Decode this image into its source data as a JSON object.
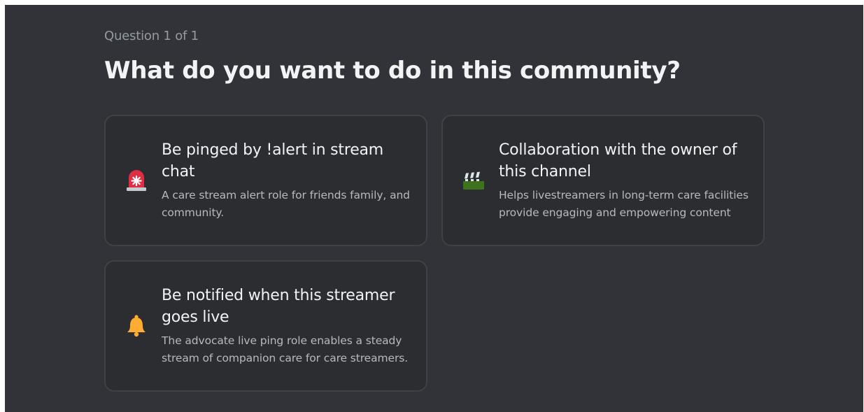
{
  "progress": "Question 1 of 1",
  "question": "What do you want to do in this community?",
  "options": [
    {
      "title": "Be pinged by !alert in stream chat",
      "description": "A care stream alert role for friends family, and community.",
      "icon": "rotating-light-icon"
    },
    {
      "title": "Collaboration with the owner of this channel",
      "description": "Helps livestreamers in long-term care facilities provide engaging and empowering content",
      "icon": "clapper-board-icon"
    },
    {
      "title": "Be notified when this streamer goes live",
      "description": "The advocate live ping role enables a steady stream of companion care for care streamers.",
      "icon": "bell-icon"
    }
  ],
  "colors": {
    "background": "#313338",
    "card": "#2b2d31",
    "card_border": "#3f4147",
    "title_text": "#f2f3f5",
    "muted_text": "#b5bac1"
  }
}
